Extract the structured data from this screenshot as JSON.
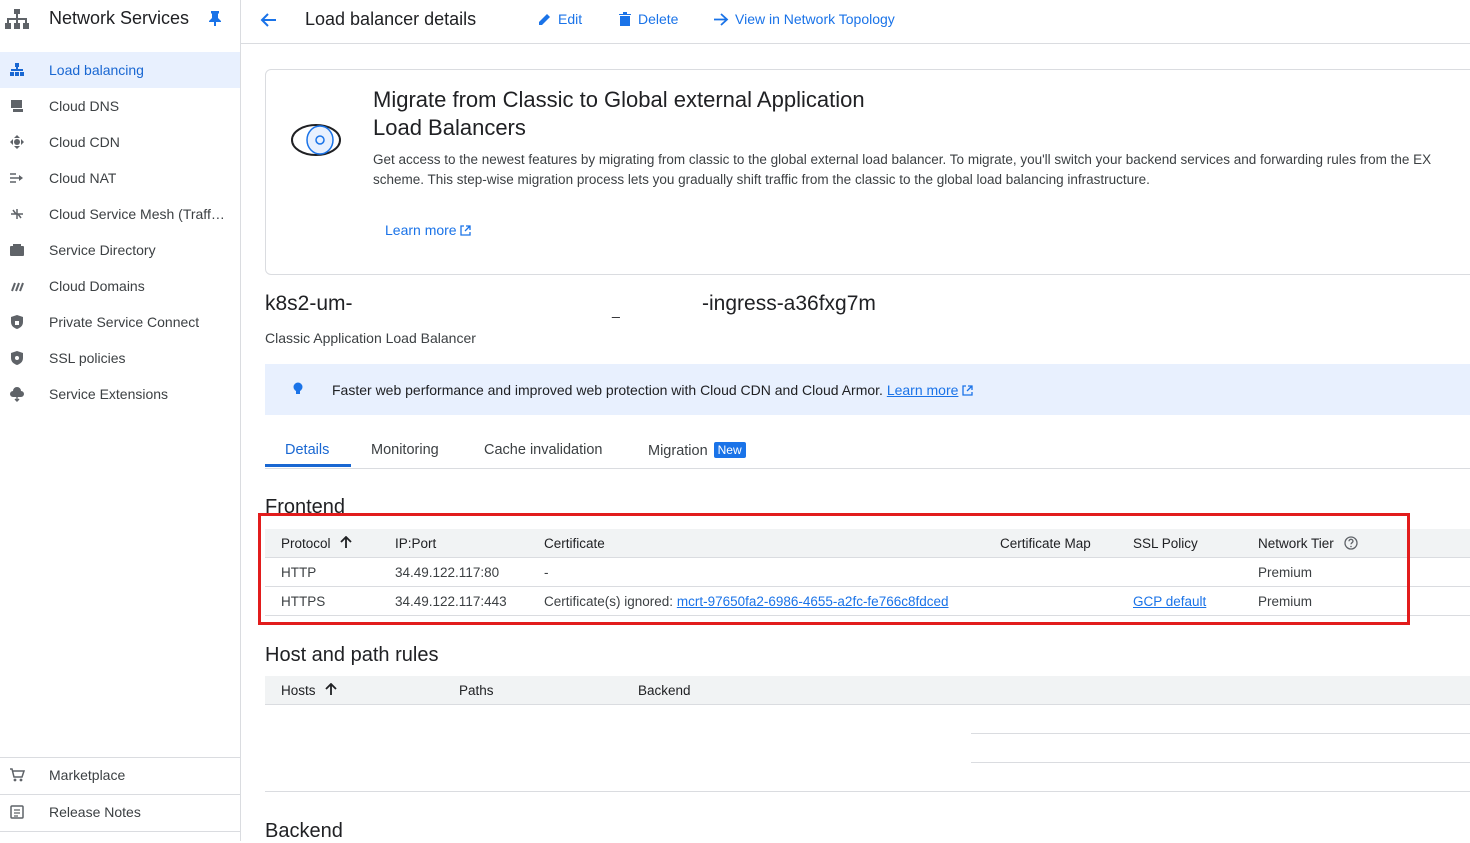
{
  "sidebar": {
    "title": "Network Services",
    "items": [
      {
        "label": "Load balancing",
        "icon": "load-balancing-icon",
        "active": true
      },
      {
        "label": "Cloud DNS",
        "icon": "dns-icon"
      },
      {
        "label": "Cloud CDN",
        "icon": "cdn-icon"
      },
      {
        "label": "Cloud NAT",
        "icon": "nat-icon"
      },
      {
        "label": "Cloud Service Mesh (Traff…",
        "icon": "service-mesh-icon"
      },
      {
        "label": "Service Directory",
        "icon": "service-directory-icon"
      },
      {
        "label": "Cloud Domains",
        "icon": "domains-icon"
      },
      {
        "label": "Private Service Connect",
        "icon": "private-service-connect-icon"
      },
      {
        "label": "SSL policies",
        "icon": "ssl-shield-icon"
      },
      {
        "label": "Service Extensions",
        "icon": "service-extensions-icon"
      }
    ],
    "footer": [
      {
        "label": "Marketplace",
        "icon": "cart-icon"
      },
      {
        "label": "Release Notes",
        "icon": "notes-icon"
      }
    ]
  },
  "topbar": {
    "title": "Load balancer details",
    "edit": "Edit",
    "delete": "Delete",
    "topology": "View in Network Topology"
  },
  "banner": {
    "title": "Migrate from Classic to Global external Application Load Balancers",
    "line1": "Get access to the newest features by migrating from classic to the global external load balancer. To migrate, you'll switch your backend services and forwarding rules from the EX",
    "line2": "scheme. This step-wise migration process lets you gradually shift traffic from the classic to the global load balancing infrastructure.",
    "learn_more": "Learn more"
  },
  "lb": {
    "name_prefix": "k8s2-um-",
    "name_sep": "_",
    "name_suffix": "-ingress-a36fxg7m",
    "type": "Classic Application Load Balancer"
  },
  "info": {
    "text": "Faster web performance and improved web protection with Cloud CDN and Cloud Armor.",
    "link": "Learn more"
  },
  "tabs": [
    "Details",
    "Monitoring",
    "Cache invalidation",
    "Migration"
  ],
  "tab_badge": "New",
  "frontend": {
    "title": "Frontend",
    "columns": [
      "Protocol",
      "IP:Port",
      "Certificate",
      "Certificate Map",
      "SSL Policy",
      "Network Tier"
    ],
    "rows": [
      {
        "protocol": "HTTP",
        "ipport": "34.49.122.117:80",
        "certificate": "-",
        "cert_map": "",
        "ssl_policy": "",
        "tier": "Premium"
      },
      {
        "protocol": "HTTPS",
        "ipport": "34.49.122.117:443",
        "certificate_prefix": "Certificate(s) ignored:",
        "certificate": "mcrt-97650fa2-6986-4655-a2fc-fe766c8fdced",
        "cert_map": "",
        "ssl_policy": "GCP default",
        "tier": "Premium"
      }
    ]
  },
  "hostpath": {
    "title": "Host and path rules",
    "columns": [
      "Hosts",
      "Paths",
      "Backend"
    ]
  },
  "backend": {
    "title": "Backend"
  },
  "colors": {
    "accent": "#1a73e8",
    "active_bg": "#e8f0fe",
    "highlight": "#e21c1c"
  }
}
